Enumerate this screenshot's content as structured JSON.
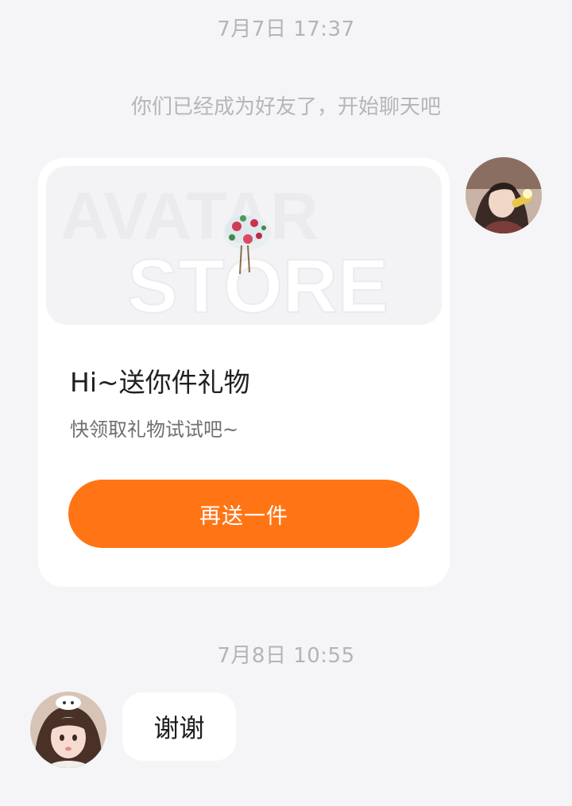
{
  "timestamps": [
    "7月7日 17:37",
    "7月8日 10:55"
  ],
  "system_message": "你们已经成为好友了，开始聊天吧",
  "gift_card": {
    "banner_text_line1": "AVATAR",
    "banner_text_line2": "STORE",
    "title": "Hi~送你件礼物",
    "subtitle": "快领取礼物试试吧~",
    "button_label": "再送一件",
    "button_color": "#ff7516"
  },
  "reply_message": "谢谢",
  "icons": {
    "gift_item": "hat-icon",
    "sender_avatar": "avatar",
    "recipient_avatar": "avatar"
  }
}
